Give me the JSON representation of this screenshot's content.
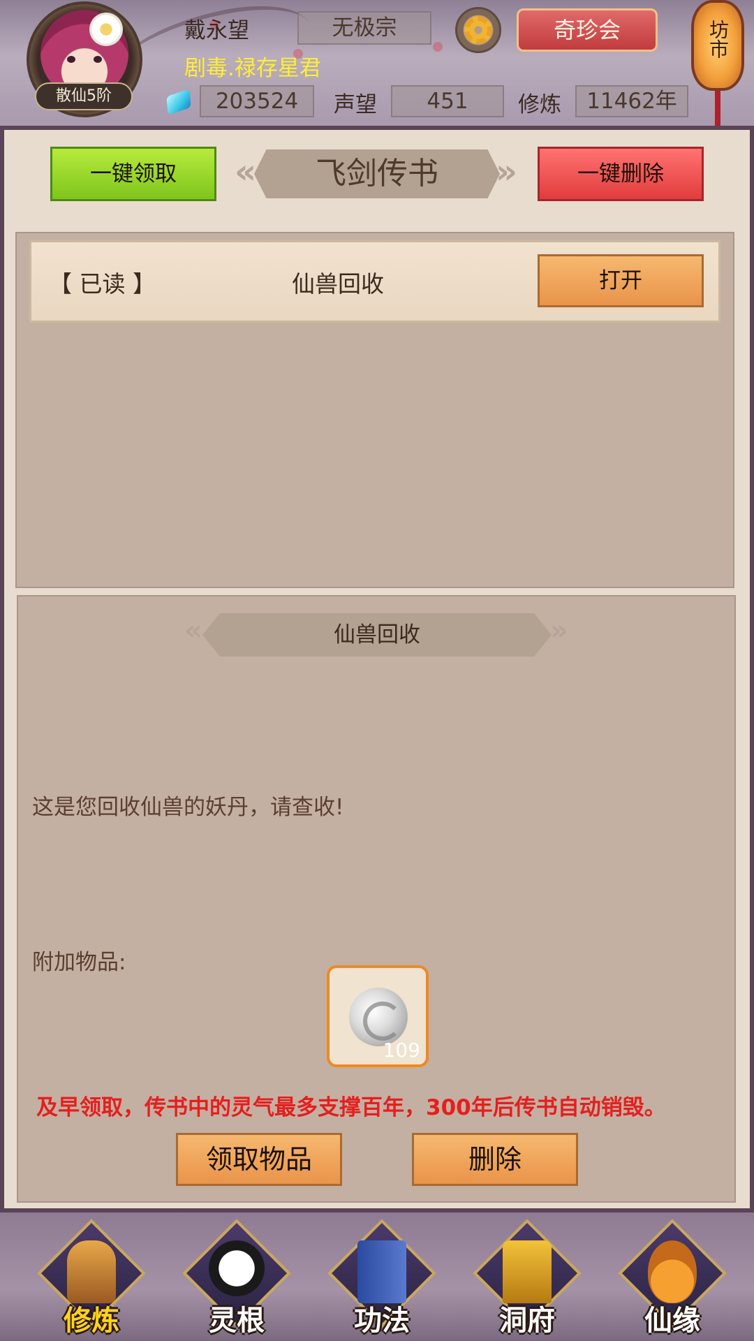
{
  "header": {
    "player_name": "戴永望",
    "sect": "无极宗",
    "title": "剧毒.禄存星君",
    "rank": "散仙5阶",
    "shop_button": "奇珍会",
    "market_label": "坊市",
    "spirit_stones": "203524",
    "reputation_label": "声望",
    "reputation": "451",
    "cultivation_label": "修炼",
    "cultivation": "11462年"
  },
  "mailbox": {
    "title": "飞剑传书",
    "claim_all_button": "一键领取",
    "delete_all_button": "一键删除",
    "messages": [
      {
        "status": "【 已读 】",
        "subject": "仙兽回收",
        "action": "打开"
      }
    ]
  },
  "detail": {
    "title": "仙兽回收",
    "body": "这是您回收仙兽的妖丹，请查收!",
    "attachments_label": "附加物品:",
    "attachment": {
      "icon": "silver-orb-icon",
      "count": "109"
    },
    "warning": "及早领取，传书中的灵气最多支撑百年，300年后传书自动销毁。",
    "claim_button": "领取物品",
    "delete_button": "删除"
  },
  "bottom_nav": [
    {
      "label": "修炼",
      "active": true
    },
    {
      "label": "灵根",
      "active": false
    },
    {
      "label": "功法",
      "active": false
    },
    {
      "label": "洞府",
      "active": false
    },
    {
      "label": "仙缘",
      "active": false
    }
  ],
  "colors": {
    "warning": "#e61e1e",
    "title_yellow": "#ffee33",
    "attachment_border": "#ee8a22"
  }
}
